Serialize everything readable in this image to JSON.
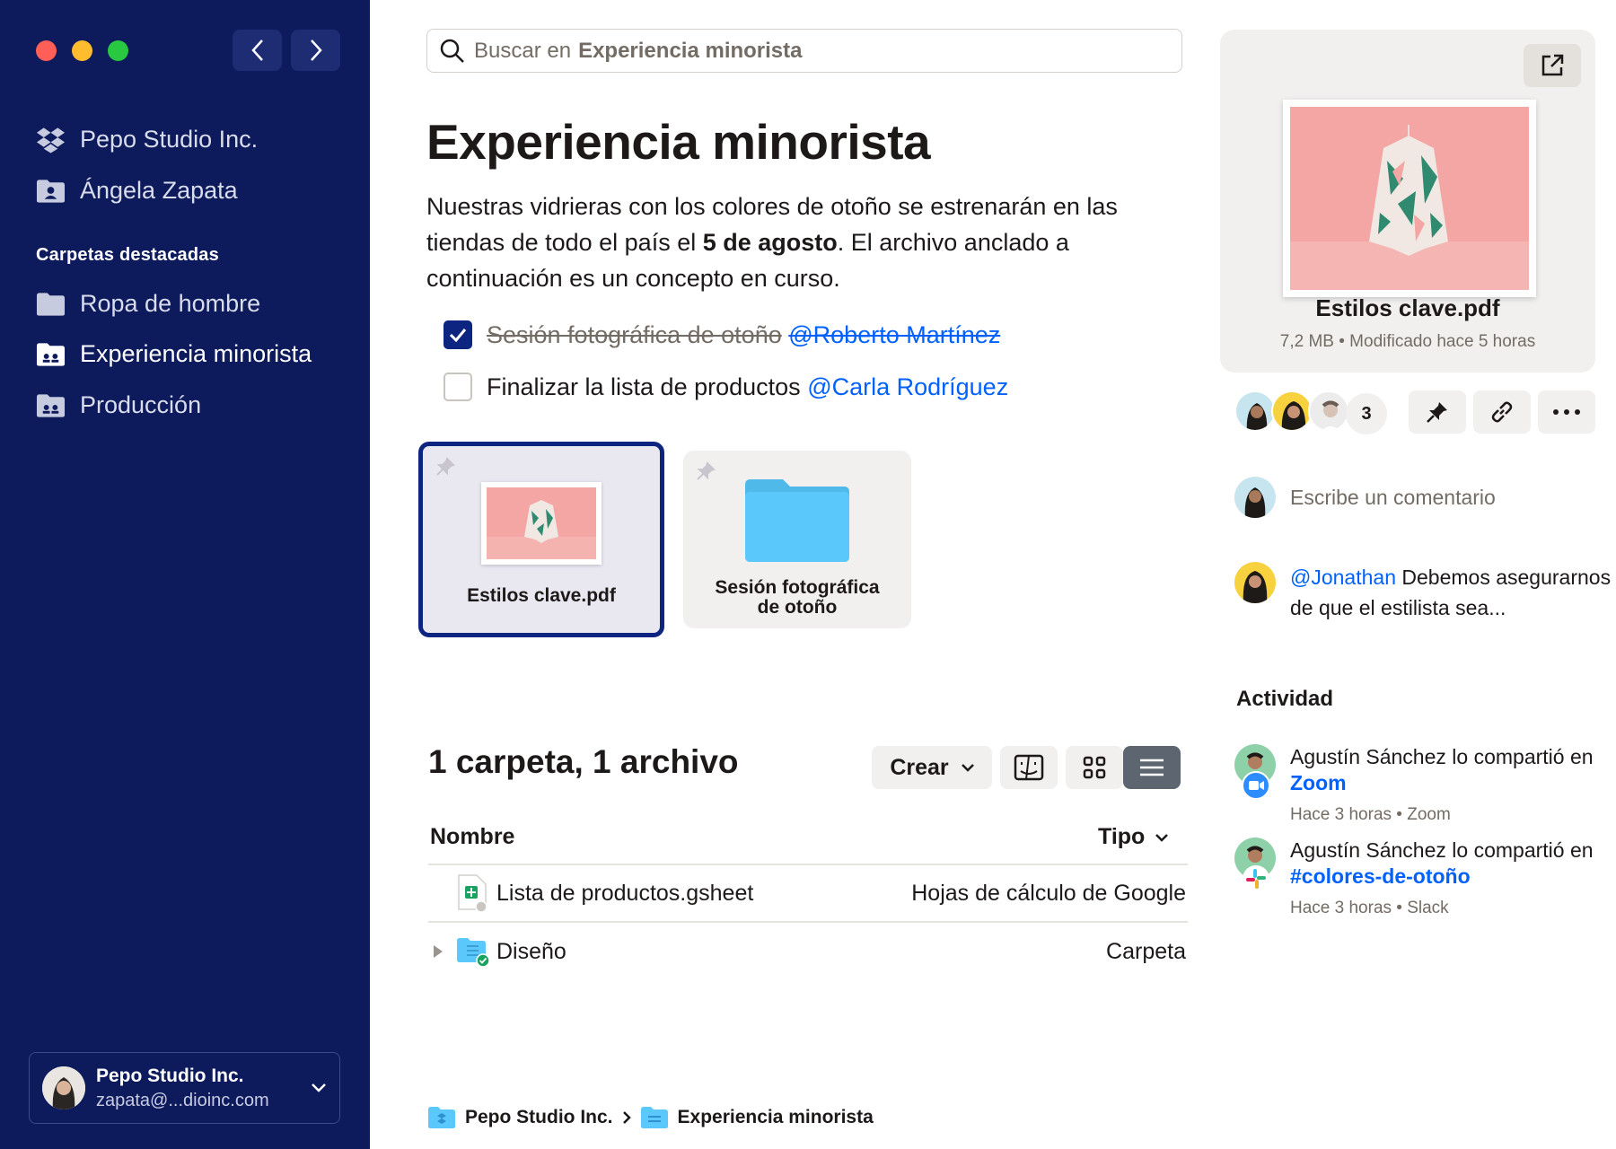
{
  "sidebar": {
    "team": "Pepo Studio Inc.",
    "user": "Ángela Zapata",
    "section_heading": "Carpetas destacadas",
    "folders": [
      "Ropa de hombre",
      "Experiencia minorista",
      "Producción"
    ],
    "account": {
      "name": "Pepo Studio Inc.",
      "email": "zapata@...dioinc.com"
    }
  },
  "search": {
    "prefix": "Buscar en",
    "scope": "Experiencia minorista"
  },
  "main": {
    "title": "Experiencia minorista",
    "desc_1": "Nuestras vidrieras con los colores de otoño se estrenarán en las tiendas de todo el país el ",
    "desc_bold": "5 de agosto",
    "desc_2": ". El archivo anclado a continuación es un concepto en curso.",
    "tasks": [
      {
        "text": "Sesión fotográfica de otoño",
        "mention": "@Roberto Martínez",
        "done": true
      },
      {
        "text": "Finalizar la lista de productos",
        "mention": "@Carla Rodríguez",
        "done": false
      }
    ],
    "pinned": [
      {
        "label": "Estilos clave.pdf"
      },
      {
        "label_line1": "Sesión fotográfica",
        "label_line2": "de otoño"
      }
    ],
    "count_title": "1 carpeta, 1 archivo",
    "create_label": "Crear",
    "columns": {
      "name": "Nombre",
      "type": "Tipo"
    },
    "rows": [
      {
        "name": "Lista de productos.gsheet",
        "type": "Hojas de cálculo de Google"
      },
      {
        "name": "Diseño",
        "type": "Carpeta"
      }
    ],
    "breadcrumb": [
      "Pepo Studio Inc.",
      "Experiencia minorista"
    ]
  },
  "preview": {
    "title": "Estilos clave.pdf",
    "meta": "7,2 MB • Modificado hace 5 horas",
    "members_extra": "3",
    "comment_placeholder": "Escribe un comentario",
    "comment": {
      "mention": "@Jonathan",
      "text": " Debemos asegurarnos de que el estilista sea..."
    },
    "activity_heading": "Actividad",
    "activity": [
      {
        "text": "Agustín Sánchez lo compartió en ",
        "link": "Zoom",
        "meta": "Hace 3 horas • Zoom"
      },
      {
        "text": "Agustín Sánchez lo compartió en ",
        "link": "#colores-de-otoño",
        "meta": "Hace 3 horas • Slack"
      }
    ]
  },
  "colors": {
    "sidebar": "#0d1a5c",
    "accent": "#0061fe",
    "selected_border": "#0d2481",
    "folder": "#5ac8fa"
  }
}
